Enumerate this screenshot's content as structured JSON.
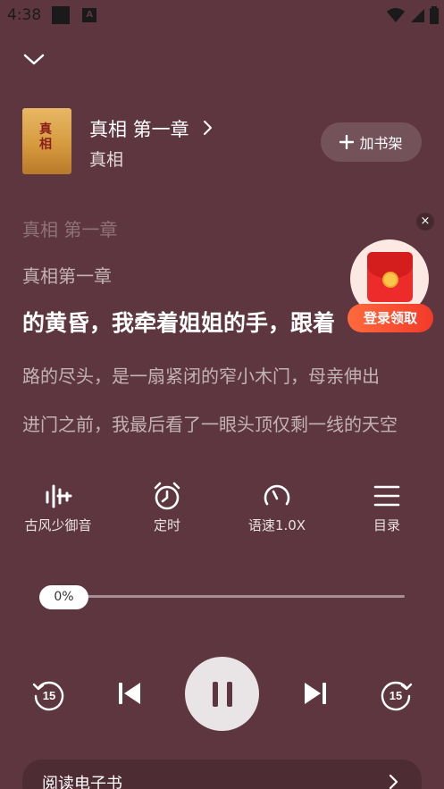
{
  "status_bar": {
    "time": "4:38"
  },
  "book": {
    "title": "真相 第一章",
    "author": "真相",
    "cover_text": "真相"
  },
  "shelf_button": {
    "label": "加书架"
  },
  "text_lines": [
    "真相 第一章",
    "真相第一章",
    "的黄昏，我牵着姐姐的手，跟着",
    "路的尽头，是一扇紧闭的窄小木门，母亲伸出",
    "进门之前，我最后看了一眼头顶仅剩一线的天空"
  ],
  "promo": {
    "label": "登录领取",
    "close": "×"
  },
  "controls": [
    {
      "label": "古风少御音",
      "icon": "voice-equalizer-icon"
    },
    {
      "label": "定时",
      "icon": "alarm-clock-icon"
    },
    {
      "label": "语速1.0X",
      "icon": "speedometer-icon"
    },
    {
      "label": "目录",
      "icon": "menu-list-icon"
    }
  ],
  "progress": {
    "label": "0%",
    "value": 0
  },
  "playback": {
    "rewind_seconds": "15",
    "forward_seconds": "15",
    "state": "playing"
  },
  "read_ebook": {
    "label": "阅读电子书"
  },
  "colors": {
    "background": "#5e363f",
    "promo_red": "#f23a2a"
  }
}
